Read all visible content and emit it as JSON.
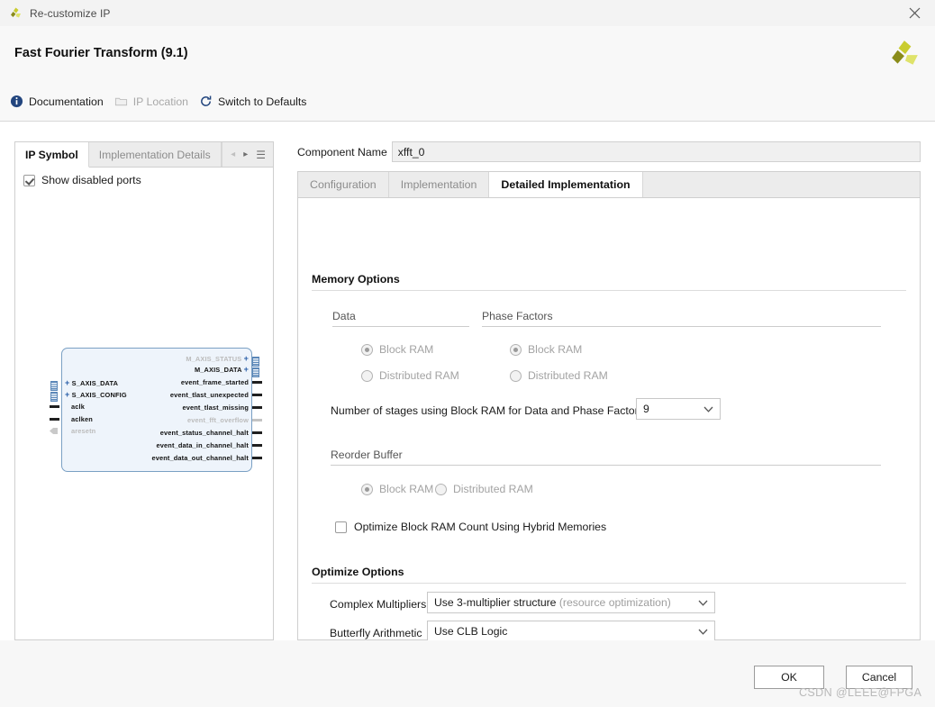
{
  "window": {
    "title": "Re-customize IP",
    "close_icon": "close-icon",
    "logo_icon": "xilinx-logo-icon"
  },
  "header": {
    "title": "Fast Fourier Transform (9.1)",
    "logo_icon": "xilinx-logo-icon"
  },
  "toolbar": {
    "items": [
      {
        "label": "Documentation",
        "icon": "info-icon",
        "disabled": false
      },
      {
        "label": "IP Location",
        "icon": "folder-icon",
        "disabled": true
      },
      {
        "label": "Switch to Defaults",
        "icon": "refresh-icon",
        "disabled": false
      }
    ]
  },
  "left_panel": {
    "tabs": [
      {
        "label": "IP Symbol",
        "active": true
      },
      {
        "label": "Implementation Details",
        "active": false
      }
    ],
    "nav": {
      "prev_icon": "triangle-left-icon",
      "next_icon": "triangle-right-icon",
      "menu_icon": "hamburger-menu-icon"
    },
    "show_disabled_ports": {
      "label": "Show disabled ports",
      "checked": true
    },
    "symbol": {
      "left_ports": [
        {
          "name": "S_AXIS_DATA",
          "type": "bus",
          "disabled": false
        },
        {
          "name": "S_AXIS_CONFIG",
          "type": "bus",
          "disabled": false
        },
        {
          "name": "aclk",
          "type": "pin",
          "disabled": false
        },
        {
          "name": "aclken",
          "type": "pin",
          "disabled": false
        },
        {
          "name": "aresetn",
          "type": "reset",
          "disabled": true
        }
      ],
      "right_ports": [
        {
          "name": "M_AXIS_STATUS",
          "type": "bus",
          "disabled": true
        },
        {
          "name": "M_AXIS_DATA",
          "type": "bus",
          "disabled": false
        },
        {
          "name": "event_frame_started",
          "type": "pin",
          "disabled": false
        },
        {
          "name": "event_tlast_unexpected",
          "type": "pin",
          "disabled": false
        },
        {
          "name": "event_tlast_missing",
          "type": "pin",
          "disabled": false
        },
        {
          "name": "event_fft_overflow",
          "type": "pin",
          "disabled": true
        },
        {
          "name": "event_status_channel_halt",
          "type": "pin",
          "disabled": false
        },
        {
          "name": "event_data_in_channel_halt",
          "type": "pin",
          "disabled": false
        },
        {
          "name": "event_data_out_channel_halt",
          "type": "pin",
          "disabled": false
        }
      ]
    }
  },
  "component_name": {
    "label": "Component Name",
    "value": "xfft_0"
  },
  "main_tabs": [
    {
      "label": "Configuration",
      "active": false
    },
    {
      "label": "Implementation",
      "active": false
    },
    {
      "label": "Detailed Implementation",
      "active": true
    }
  ],
  "memory_options": {
    "section_title": "Memory Options",
    "data_group": {
      "label": "Data",
      "options": [
        {
          "label": "Block RAM",
          "selected": true,
          "disabled": true
        },
        {
          "label": "Distributed RAM",
          "selected": false,
          "disabled": true
        }
      ]
    },
    "phase_factors_group": {
      "label": "Phase Factors",
      "options": [
        {
          "label": "Block RAM",
          "selected": true,
          "disabled": true
        },
        {
          "label": "Distributed RAM",
          "selected": false,
          "disabled": true
        }
      ]
    },
    "stages": {
      "label": "Number of stages using Block RAM for Data and Phase Factors",
      "value": "9",
      "chevron_icon": "chevron-down-icon"
    },
    "reorder_buffer": {
      "label": "Reorder Buffer",
      "options": [
        {
          "label": "Block RAM",
          "selected": true,
          "disabled": true
        },
        {
          "label": "Distributed RAM",
          "selected": false,
          "disabled": true
        }
      ]
    },
    "hybrid": {
      "label": "Optimize Block RAM Count Using Hybrid Memories",
      "checked": false
    }
  },
  "optimize_options": {
    "section_title": "Optimize Options",
    "complex_multipliers": {
      "label": "Complex Multipliers",
      "value": "Use 3-multiplier structure ",
      "value_muted": "(resource optimization)",
      "chevron_icon": "chevron-down-icon"
    },
    "butterfly_arithmetic": {
      "label": "Butterfly Arithmetic",
      "value": "Use CLB Logic",
      "chevron_icon": "chevron-down-icon"
    }
  },
  "footer": {
    "ok_label": "OK",
    "cancel_label": "Cancel",
    "watermark": "CSDN @LEEE@FPGA"
  }
}
